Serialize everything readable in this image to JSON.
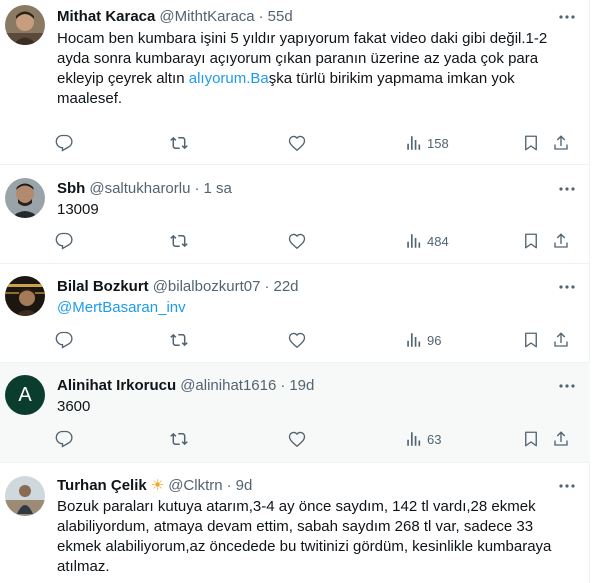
{
  "tweets": [
    {
      "name": "Mithat Karaca",
      "handle": "@MithtKaraca",
      "time": "55d",
      "text_parts": [
        "Hocam ben kumbara işini 5 yıldır yapıyorum fakat video daki gibi değil.1-2 ayda sonra kumbarayı açıyorum çıkan paranın üzerine az yada çok para ekleyip çeyrek altın ",
        "alıyorum.Ba",
        "şka türlü birikim yapmama imkan yok maalesef."
      ],
      "views": "158"
    },
    {
      "name": "Sbh",
      "handle": "@saltukharorlu",
      "time": "1 sa",
      "text": "13009",
      "views": "484"
    },
    {
      "name": "Bilal Bozkurt",
      "handle": "@bilalbozkurt07",
      "time": "22d",
      "mention": "@MertBasaran_inv",
      "views": "96"
    },
    {
      "name": "Alinihat Irkorucu",
      "handle": "@alinihat1616",
      "time": "19d",
      "avatar_letter": "A",
      "text": "3600",
      "views": "63"
    },
    {
      "name": "Turhan Çelik",
      "handle": "@Clktrn",
      "time": "9d",
      "text": "Bozuk paraları kutuya atarım,3-4 ay önce saydım, 142 tl vardı,28 ekmek alabiliyordum, atmaya devam ettim, sabah saydım 268 tl var, sadece 33 ekmek alabiliyorum,az öncedede bu twitinizi gördüm, kesinlikle kumbaraya atılmaz."
    }
  ],
  "separator": "·",
  "colors": {
    "link": "#1d9bf0",
    "muted": "#536471",
    "text": "#0f1419",
    "highlight_bg": "#f7f9f9"
  },
  "icons": [
    "more-icon",
    "reply-icon",
    "retweet-icon",
    "like-icon",
    "views-icon",
    "bookmark-icon",
    "share-icon",
    "sun-emoji"
  ]
}
